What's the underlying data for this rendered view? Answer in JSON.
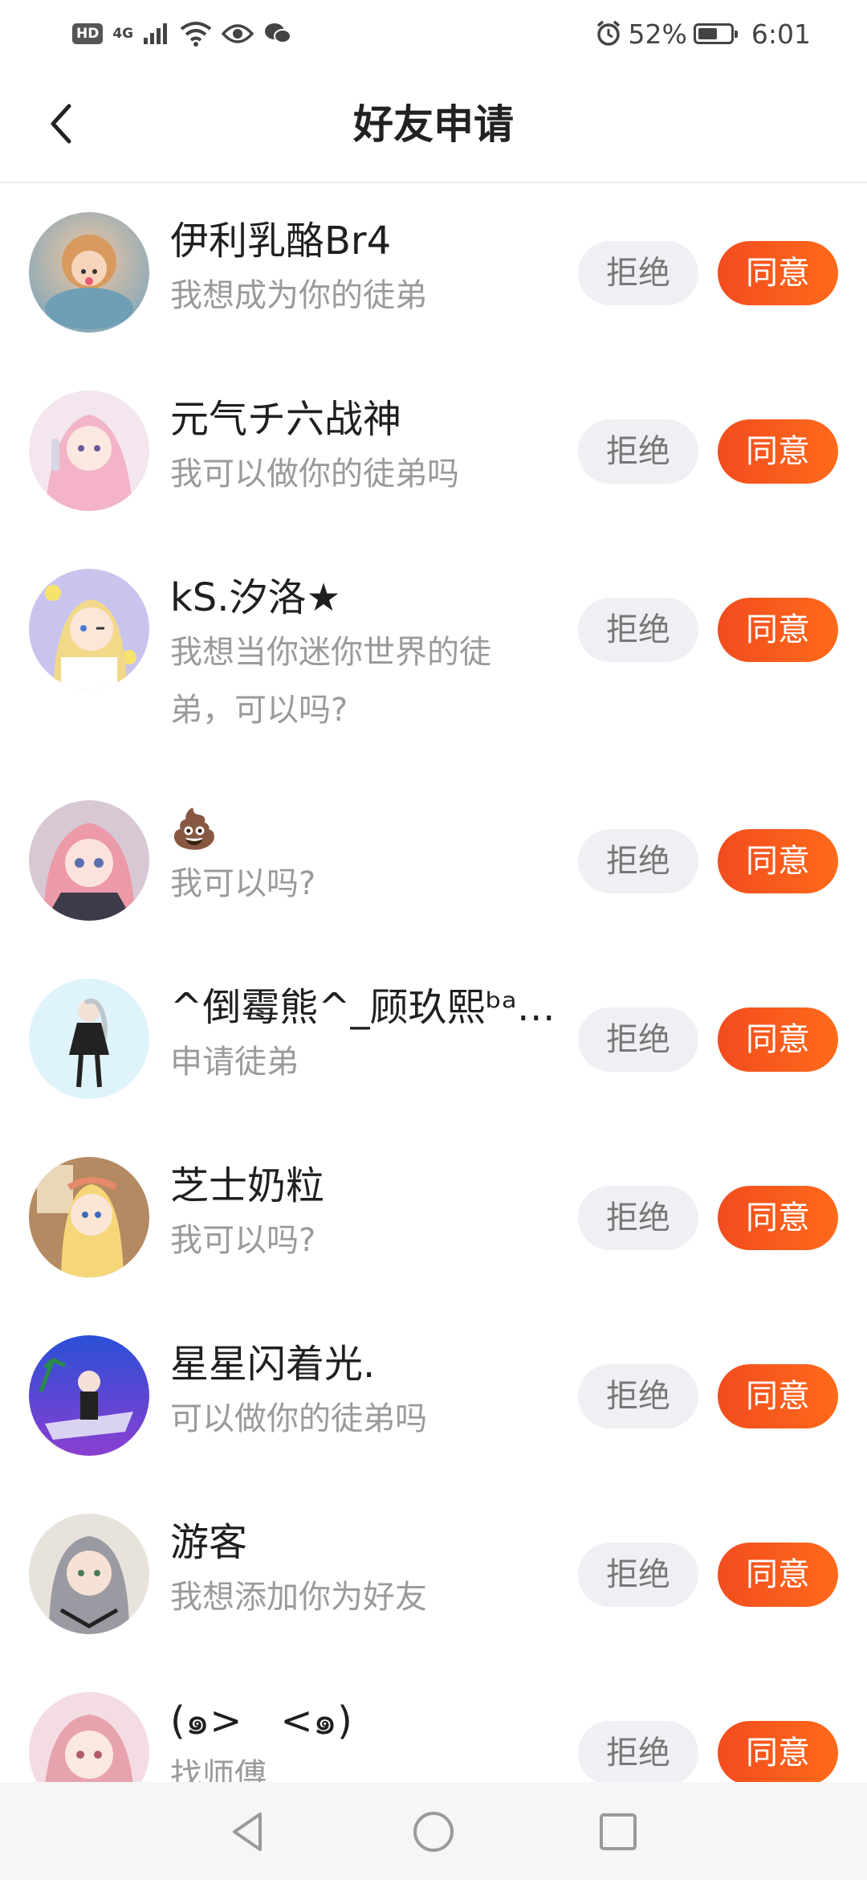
{
  "status_bar": {
    "hd": "HD",
    "network": "4G",
    "battery_percent": "52%",
    "battery_level": 0.52,
    "time": "6:01"
  },
  "header": {
    "title": "好友申请"
  },
  "buttons": {
    "reject_label": "拒绝",
    "accept_label": "同意"
  },
  "requests": [
    {
      "name": "伊利乳酪Br4",
      "message": "我想成为你的徒弟"
    },
    {
      "name": "元气チ六战神",
      "message": "我可以做你的徒弟吗"
    },
    {
      "name": "kS.汐洛★",
      "message": "我想当你迷你世界的徒弟，可以吗?"
    },
    {
      "name": "💩",
      "message": "我可以吗?"
    },
    {
      "name": "^倒霉熊^_顾玖熙ᵇᵃ…",
      "message": "申请徒弟"
    },
    {
      "name": "芝士奶粒",
      "message": "我可以吗?"
    },
    {
      "name": "星星闪着光.",
      "message": "可以做你的徒弟吗"
    },
    {
      "name": "游客",
      "message": "我想添加你为好友"
    },
    {
      "name": "(๑>　<๑)",
      "message": "找师傅"
    }
  ],
  "colors": {
    "accent": "#f6541c",
    "reject_bg": "#eef0f3",
    "secondary_text": "#9a9a9a"
  },
  "icons": {
    "back": "chevron-left-icon",
    "nav_back": "triangle-back-icon",
    "nav_home": "circle-home-icon",
    "nav_recent": "square-recent-icon"
  }
}
